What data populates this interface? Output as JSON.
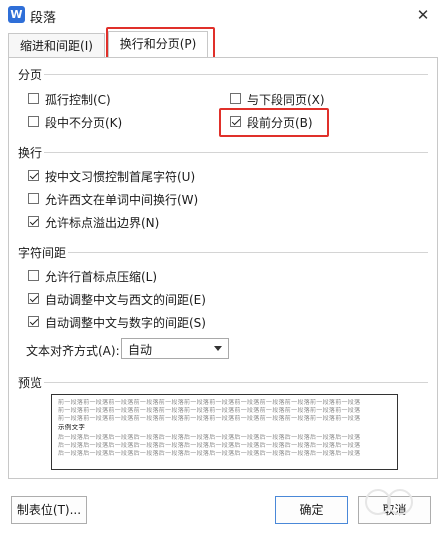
{
  "window": {
    "app_icon": "W",
    "title": "段落",
    "close_glyph": "✕"
  },
  "tabs": [
    {
      "label": "缩进和间距(I)"
    },
    {
      "label": "换行和分页(P)",
      "active": true
    }
  ],
  "sections": {
    "pagination": {
      "title": "分页",
      "items": [
        {
          "label": "孤行控制(C)",
          "checked": false
        },
        {
          "label": "与下段同页(X)",
          "checked": false
        },
        {
          "label": "段中不分页(K)",
          "checked": false
        },
        {
          "label": "段前分页(B)",
          "checked": true
        }
      ]
    },
    "line_break": {
      "title": "换行",
      "items": [
        {
          "label": "按中文习惯控制首尾字符(U)",
          "checked": true
        },
        {
          "label": "允许西文在单词中间换行(W)",
          "checked": false
        },
        {
          "label": "允许标点溢出边界(N)",
          "checked": true
        }
      ]
    },
    "char_spacing": {
      "title": "字符间距",
      "items": [
        {
          "label": "允许行首标点压缩(L)",
          "checked": false
        },
        {
          "label": "自动调整中文与西文的间距(E)",
          "checked": true
        },
        {
          "label": "自动调整中文与数字的间距(S)",
          "checked": true
        }
      ],
      "align_label": "文本对齐方式(A):",
      "align_value": "自动"
    },
    "preview": {
      "title": "预览",
      "prev_para": "前一段落前一段落前一段落前一段落前一段落前一段落前一段落前一段落前一段落前一段落前一段落前一段落",
      "sample": "示例文字",
      "next_para": "后一段落后一段落后一段落后一段落后一段落后一段落后一段落后一段落后一段落后一段落后一段落后一段落"
    }
  },
  "buttons": {
    "tabs_label": "制表位(T)...",
    "ok_label": "确定",
    "cancel_label": "取消"
  },
  "colors": {
    "highlight": "#e0302a",
    "accent": "#2f6fd8"
  }
}
